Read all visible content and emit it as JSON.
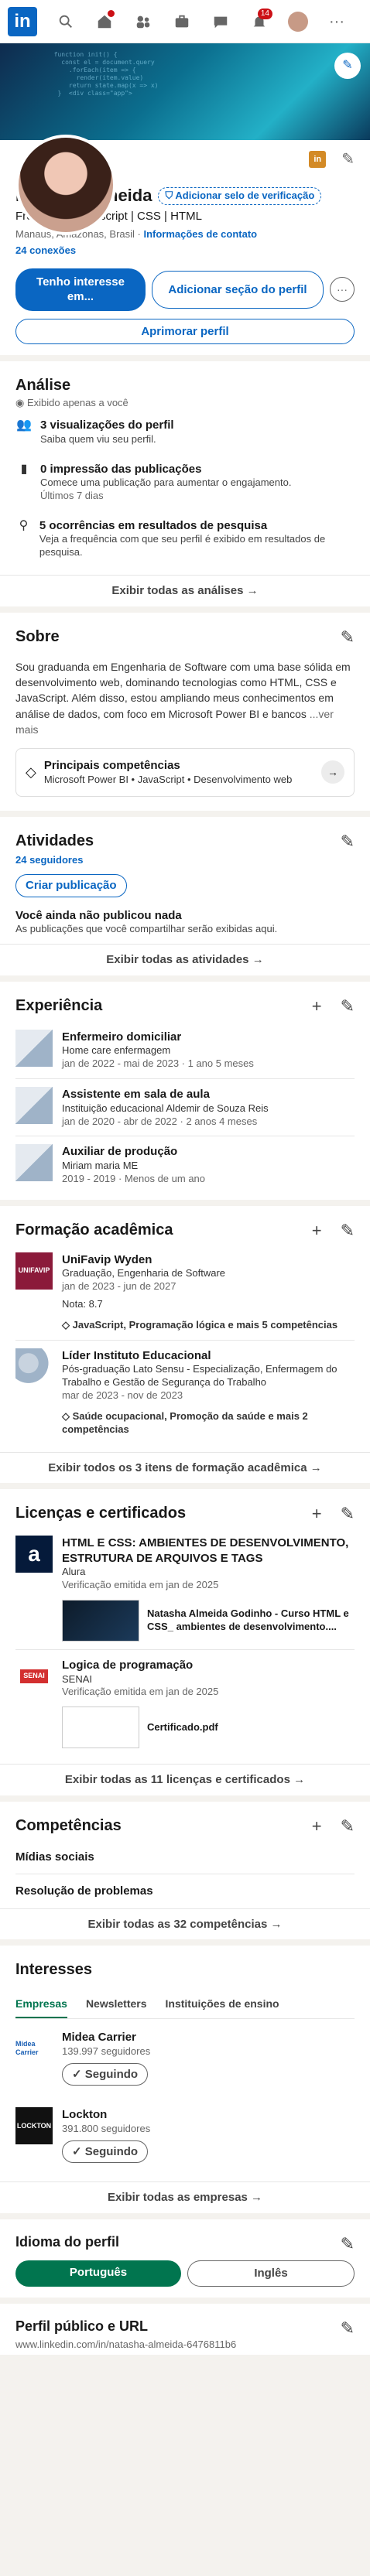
{
  "topnav": {
    "logo": "in",
    "messages_badge": "",
    "notifications_badge": "14",
    "more": "···"
  },
  "profile": {
    "name": "Natasha Almeida",
    "verify_label": "Adicionar selo de verificação",
    "headline": "Front-end | Javascript | CSS | HTML",
    "location": "Manaus, Amazonas, Brasil",
    "contact_link": "Informações de contato",
    "connections": "24 conexões",
    "btn_interest": "Tenho interesse em...",
    "btn_add_section": "Adicionar seção do perfil",
    "btn_enhance": "Aprimorar perfil"
  },
  "analysis": {
    "title": "Análise",
    "subtitle": "Exibido apenas a você",
    "items": [
      {
        "title": "3 visualizações do perfil",
        "desc": "Saiba quem viu seu perfil."
      },
      {
        "title": "0 impressão das publicações",
        "desc": "Comece uma publicação para aumentar o engajamento.",
        "extra": "Últimos 7 dias"
      },
      {
        "title": "5 ocorrências em resultados de pesquisa",
        "desc": "Veja a frequência com que seu perfil é exibido em resultados de pesquisa."
      }
    ],
    "footer": "Exibir todas as análises →"
  },
  "about": {
    "title": "Sobre",
    "text": "Sou graduanda em Engenharia de Software com uma base sólida em desenvolvimento web, dominando tecnologias como HTML, CSS e JavaScript. Além disso, estou ampliando meus conhecimentos em análise de dados, com foco em Microsoft Power BI e bancos",
    "more": "...ver mais",
    "top_skills_title": "Principais competências",
    "top_skills": "Microsoft Power BI • JavaScript • Desenvolvimento web"
  },
  "activity": {
    "title": "Atividades",
    "followers": "24 seguidores",
    "create_post": "Criar publicação",
    "empty_title": "Você ainda não publicou nada",
    "empty_desc": "As publicações que você compartilhar serão exibidas aqui.",
    "footer": "Exibir todas as atividades →"
  },
  "experience": {
    "title": "Experiência",
    "items": [
      {
        "title": "Enfermeiro domiciliar",
        "org": "Home care enfermagem",
        "date": "jan de 2022 - mai de 2023 · 1 ano 5 meses"
      },
      {
        "title": "Assistente em sala de aula",
        "org": "Instituição educacional Aldemir de Souza Reis",
        "date": "jan de 2020 - abr de 2022 · 2 anos 4 meses"
      },
      {
        "title": "Auxiliar de produção",
        "org": "Miriam maria ME",
        "date": "2019 - 2019 · Menos de um ano"
      }
    ]
  },
  "education": {
    "title": "Formação acadêmica",
    "items": [
      {
        "title": "UniFavip Wyden",
        "degree": "Graduação, Engenharia de Software",
        "date": "jan de 2023 - jun de 2027",
        "extra": "Nota: 8.7",
        "skills": "JavaScript, Programação lógica e mais 5 competências",
        "logo": "UNIFAVIP"
      },
      {
        "title": "Líder Instituto Educacional",
        "degree": "Pós-graduação Lato Sensu - Especialização, Enfermagem do Trabalho e Gestão de Segurança do Trabalho",
        "date": "mar de 2023 - nov de 2023",
        "skills": "Saúde ocupacional, Promoção da saúde e mais 2 competências"
      }
    ],
    "footer": "Exibir todos os 3 itens de formação acadêmica →"
  },
  "licenses": {
    "title": "Licenças e certificados",
    "items": [
      {
        "title": "HTML E CSS: AMBIENTES DE DESENVOLVIMENTO, ESTRUTURA DE ARQUIVOS E TAGS",
        "issuer": "Alura",
        "date": "Verificação emitida em jan de 2025",
        "thumb_label": "Natasha Almeida Godinho - Curso HTML e CSS_ ambientes de desenvolvimento....",
        "logo": "a"
      },
      {
        "title": "Logica de programação",
        "issuer": "SENAI",
        "date": "Verificação emitida em jan de 2025",
        "thumb_label": "Certificado.pdf",
        "logo": "SENAI"
      }
    ],
    "footer": "Exibir todas as 11 licenças e certificados →"
  },
  "skills": {
    "title": "Competências",
    "items": [
      "Mídias sociais",
      "Resolução de problemas"
    ],
    "footer": "Exibir todas as 32 competências →"
  },
  "interests": {
    "title": "Interesses",
    "tabs": [
      "Empresas",
      "Newsletters",
      "Instituições de ensino"
    ],
    "items": [
      {
        "name": "Midea Carrier",
        "followers": "139.997 seguidores",
        "button": "✓ Seguindo",
        "logo": "Midea Carrier"
      },
      {
        "name": "Lockton",
        "followers": "391.800 seguidores",
        "button": "✓ Seguindo",
        "logo": "LOCKTON"
      }
    ],
    "footer": "Exibir todas as empresas →"
  },
  "language": {
    "title": "Idioma do perfil",
    "options": [
      "Português",
      "Inglês"
    ]
  },
  "public_url": {
    "title": "Perfil público e URL",
    "url": "www.linkedin.com/in/natasha-almeida-6476811b6"
  },
  "colors": {
    "accent": "#0a66c2",
    "green": "#01754f",
    "badge": "#cc1016"
  }
}
